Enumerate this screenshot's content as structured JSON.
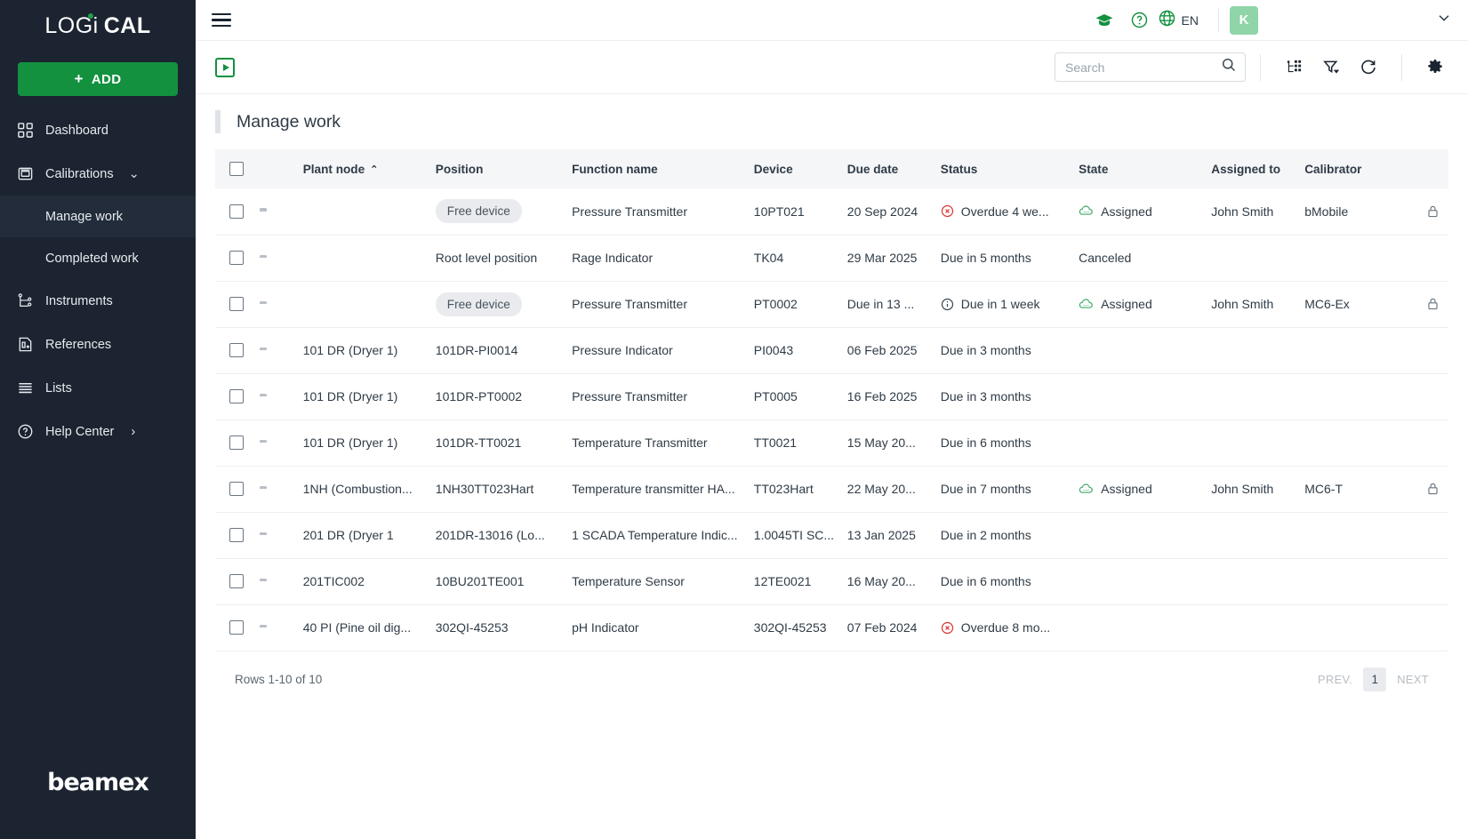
{
  "sidebar": {
    "brand": {
      "part1": "LOG",
      "part2": "i",
      "part3": "CAL"
    },
    "add_label": "ADD",
    "add_plus": "+",
    "items": [
      {
        "label": "Dashboard",
        "icon": "dashboard-icon"
      },
      {
        "label": "Calibrations",
        "icon": "calibrations-icon",
        "caret": "⌄"
      },
      {
        "label": "Instruments",
        "icon": "instruments-icon"
      },
      {
        "label": "References",
        "icon": "references-icon"
      },
      {
        "label": "Lists",
        "icon": "lists-icon"
      },
      {
        "label": "Help Center",
        "icon": "help-icon",
        "chevron": "›"
      }
    ],
    "subitems": [
      {
        "label": "Manage work",
        "active": true
      },
      {
        "label": "Completed work",
        "active": false
      }
    ],
    "footer_logo": "beamex"
  },
  "topbar": {
    "menu_icon": "hamburger-icon",
    "graduation_icon": "graduation-cap-icon",
    "help_icon": "question-circle-icon",
    "globe_icon": "globe-icon",
    "language": "EN",
    "avatar_initial": "K",
    "chevron": "⌄"
  },
  "toolbar": {
    "play_icon": "play-box-icon",
    "search": {
      "placeholder": "Search",
      "value": "",
      "icon": "search-icon"
    },
    "tree_icon": "tree-structure-icon",
    "filter_icon": "filter-icon",
    "refresh_icon": "refresh-icon",
    "settings_icon": "gear-icon"
  },
  "page": {
    "title": "Manage work"
  },
  "table": {
    "columns": [
      "Plant node",
      "Position",
      "Function name",
      "Device",
      "Due date",
      "Status",
      "State",
      "Assigned to",
      "Calibrator"
    ],
    "sort_column": "Plant node",
    "sort_caret": "⌃",
    "rows": [
      {
        "plant_node": "",
        "position": "Free device",
        "position_pill": true,
        "function_name": "Pressure Transmitter",
        "device": "10PT021",
        "due_date": "20 Sep 2024",
        "status": "Overdue 4 we...",
        "status_icon": "error-circle-icon",
        "state": "Assigned",
        "state_icon": "cloud-icon",
        "assigned_to": "John Smith",
        "calibrator": "bMobile",
        "locked": true
      },
      {
        "plant_node": "",
        "position": "Root level position",
        "position_pill": false,
        "function_name": "Rage Indicator",
        "device": "TK04",
        "due_date": "29 Mar 2025",
        "status": "Due in 5 months",
        "status_icon": "",
        "state": "Canceled",
        "state_icon": "",
        "assigned_to": "",
        "calibrator": "",
        "locked": false
      },
      {
        "plant_node": "",
        "position": "Free device",
        "position_pill": true,
        "function_name": "Pressure Transmitter",
        "device": "PT0002",
        "due_date": "Due in 13 ...",
        "status": "Due in 1 week",
        "status_icon": "info-circle-icon",
        "state": "Assigned",
        "state_icon": "cloud-icon",
        "assigned_to": "John Smith",
        "calibrator": "MC6-Ex",
        "locked": true
      },
      {
        "plant_node": "101 DR (Dryer 1)",
        "position": "101DR-PI0014",
        "position_pill": false,
        "function_name": "Pressure Indicator",
        "device": "PI0043",
        "due_date": "06 Feb 2025",
        "status": "Due in 3 months",
        "status_icon": "",
        "state": "",
        "state_icon": "",
        "assigned_to": "",
        "calibrator": "",
        "locked": false
      },
      {
        "plant_node": "101 DR (Dryer 1)",
        "position": "101DR-PT0002",
        "position_pill": false,
        "function_name": "Pressure Transmitter",
        "device": "PT0005",
        "due_date": "16 Feb 2025",
        "status": "Due in 3 months",
        "status_icon": "",
        "state": "",
        "state_icon": "",
        "assigned_to": "",
        "calibrator": "",
        "locked": false
      },
      {
        "plant_node": "101 DR (Dryer 1)",
        "position": "101DR-TT0021",
        "position_pill": false,
        "function_name": "Temperature Transmitter",
        "device": "TT0021",
        "due_date": "15 May 20...",
        "status": "Due in 6 months",
        "status_icon": "",
        "state": "",
        "state_icon": "",
        "assigned_to": "",
        "calibrator": "",
        "locked": false
      },
      {
        "plant_node": "1NH (Combustion...",
        "position": "1NH30TT023Hart",
        "position_pill": false,
        "function_name": "Temperature transmitter HA...",
        "device": "TT023Hart",
        "due_date": "22 May 20...",
        "status": "Due in 7 months",
        "status_icon": "",
        "state": "Assigned",
        "state_icon": "cloud-icon",
        "assigned_to": "John Smith",
        "calibrator": "MC6-T",
        "locked": true
      },
      {
        "plant_node": "201 DR (Dryer 1",
        "position": "201DR-13016 (Lo...",
        "position_pill": false,
        "function_name": "1 SCADA Temperature Indic...",
        "device": "1.0045TI SC...",
        "due_date": "13 Jan 2025",
        "status": "Due in 2 months",
        "status_icon": "",
        "state": "",
        "state_icon": "",
        "assigned_to": "",
        "calibrator": "",
        "locked": false
      },
      {
        "plant_node": "201TIC002",
        "position": "10BU201TE001",
        "position_pill": false,
        "function_name": "Temperature Sensor",
        "device": "12TE0021",
        "due_date": "16 May 20...",
        "status": "Due in 6 months",
        "status_icon": "",
        "state": "",
        "state_icon": "",
        "assigned_to": "",
        "calibrator": "",
        "locked": false
      },
      {
        "plant_node": "40 PI (Pine oil dig...",
        "position": "302QI-45253",
        "position_pill": false,
        "function_name": "pH Indicator",
        "device": "302QI-45253",
        "due_date": "07 Feb 2024",
        "status": "Overdue 8 mo...",
        "status_icon": "error-circle-icon",
        "state": "",
        "state_icon": "",
        "assigned_to": "",
        "calibrator": "",
        "locked": false
      }
    ]
  },
  "footer": {
    "rows_label": "Rows 1-10 of 10",
    "prev_label": "PREV.",
    "page_number": "1",
    "next_label": "NEXT"
  },
  "colors": {
    "brand_green": "#13913f",
    "sidebar_bg": "#1b2430",
    "error_red": "#e03131",
    "state_green": "#3aa864",
    "avatar_bg": "#8fd5a8"
  }
}
